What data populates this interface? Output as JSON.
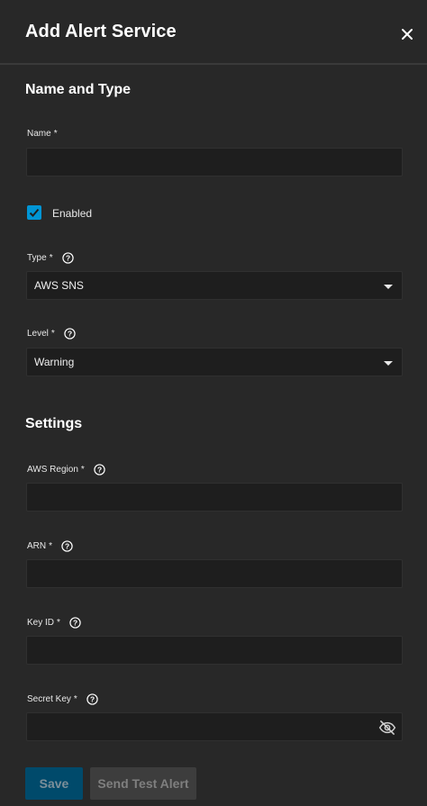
{
  "dialog": {
    "title": "Add Alert Service"
  },
  "sections": {
    "name_type": "Name and Type",
    "settings": "Settings"
  },
  "fields": {
    "name": {
      "label": "Name",
      "required": "*",
      "value": ""
    },
    "enabled": {
      "label": "Enabled",
      "checked": true
    },
    "type": {
      "label": "Type",
      "required": "*",
      "value": "AWS SNS"
    },
    "level": {
      "label": "Level",
      "required": "*",
      "value": "Warning"
    },
    "aws_region": {
      "label": "AWS Region",
      "required": "*",
      "value": ""
    },
    "arn": {
      "label": "ARN",
      "required": "*",
      "value": ""
    },
    "key_id": {
      "label": "Key ID",
      "required": "*",
      "value": ""
    },
    "secret_key": {
      "label": "Secret Key",
      "required": "*",
      "value": ""
    }
  },
  "buttons": {
    "save": "Save",
    "send_test": "Send Test Alert"
  },
  "colors": {
    "accent": "#0095d5",
    "background": "#282828",
    "input_bg": "#1e1e1e"
  }
}
